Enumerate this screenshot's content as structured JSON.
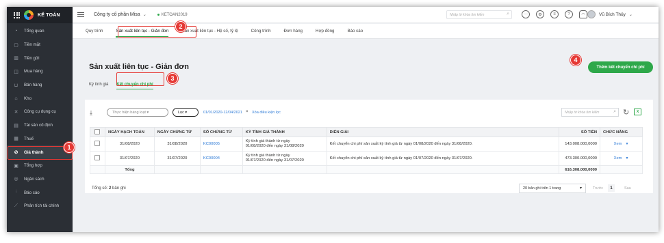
{
  "brand": {
    "name": "KẾ TOÁN"
  },
  "topbar": {
    "company": "Công ty cổ phần Misa",
    "year": "KETOAN2019",
    "search_placeholder": "Nhập từ khóa tìm kiếm",
    "user_name": "Vũ Bích Thủy"
  },
  "sidebar": {
    "items": [
      {
        "label": "Tổng quan",
        "icon": "dashboard-icon",
        "glyph": "◔"
      },
      {
        "label": "Tiền mặt",
        "icon": "cash-icon",
        "glyph": "▢"
      },
      {
        "label": "Tiền gửi",
        "icon": "bank-icon",
        "glyph": "▥"
      },
      {
        "label": "Mua hàng",
        "icon": "purchase-icon",
        "glyph": "◫"
      },
      {
        "label": "Bán hàng",
        "icon": "cart-icon",
        "glyph": "⊔"
      },
      {
        "label": "Kho",
        "icon": "warehouse-icon",
        "glyph": "⌂"
      },
      {
        "label": "Công cụ dụng cụ",
        "icon": "tools-icon",
        "glyph": "✕"
      },
      {
        "label": "Tài sản cố định",
        "icon": "asset-icon",
        "glyph": "▤"
      },
      {
        "label": "Thuế",
        "icon": "tax-icon",
        "glyph": "▦"
      },
      {
        "label": "Giá thành",
        "icon": "cost-icon",
        "glyph": "⊘"
      },
      {
        "label": "Tổng hợp",
        "icon": "summary-icon",
        "glyph": "▣"
      },
      {
        "label": "Ngân sách",
        "icon": "budget-icon",
        "glyph": "◎"
      },
      {
        "label": "Báo cáo",
        "icon": "report-icon",
        "glyph": "⫶"
      },
      {
        "label": "Phân tích tài chính",
        "icon": "analysis-icon",
        "glyph": "⟋"
      }
    ],
    "active_index": 9
  },
  "tabs": [
    "Quy trình",
    "Sản xuất liên tục - Giản đơn",
    "Sản xuất liên tục - Hệ số, tỷ lệ",
    "Công trình",
    "Đơn hàng",
    "Hợp đồng",
    "Báo cáo"
  ],
  "page": {
    "title": "Sản xuất liên tục - Giản đơn",
    "primary_button": "Thêm kết chuyển chi phí",
    "subtabs": [
      "Kỳ tính giá",
      "Kết chuyển chi phí"
    ]
  },
  "filters": {
    "status_placeholder": "Thực hiện hàng loạt",
    "filter_label": "Lọc",
    "date_range": "01/01/2020-12/04/2021",
    "clear_label": "Xóa điều kiện lọc",
    "search_placeholder": "Nhập từ khóa tìm kiếm"
  },
  "table": {
    "headers": [
      "NGÀY HẠCH TOÁN",
      "NGÀY CHỨNG TỪ",
      "SỐ CHỨNG TỪ",
      "KỲ TÍNH GIÁ THÀNH",
      "DIỄN GIẢI",
      "SỐ TIỀN",
      "CHỨC NĂNG"
    ],
    "rows": [
      {
        "ngay_hach_toan": "31/08/2020",
        "ngay_chung_tu": "31/08/2020",
        "so_chung_tu": "KC00005",
        "ky_line1": "Kỳ tính giá thành từ ngày",
        "ky_line2": "01/08/2020 đến ngày 31/08/2020",
        "dien_giai": "Kết chuyển chi phí sản xuất kỳ tính giá từ ngày 01/08/2020 đến ngày 31/08/2020.",
        "so_tien": "143.008.000,0000",
        "action": "Xem"
      },
      {
        "ngay_hach_toan": "31/07/2020",
        "ngay_chung_tu": "31/07/2020",
        "so_chung_tu": "KC00004",
        "ky_line1": "Kỳ tính giá thành từ ngày",
        "ky_line2": "01/07/2020 đến ngày 31/07/2020",
        "dien_giai": "Kết chuyển chi phí sản xuất kỳ tính giá từ ngày 01/07/2020 đến ngày 31/07/2020.",
        "so_tien": "473.300.000,0000",
        "action": "Xem"
      }
    ],
    "total_label": "Tổng",
    "total_value": "616.308.000,0000"
  },
  "footer": {
    "count_prefix": "Tổng số: ",
    "count_value": "2",
    "count_suffix": " bản ghi",
    "page_size": "20 bản ghi trên 1 trang",
    "prev": "Trước",
    "page": "1",
    "next": "Sau"
  },
  "annotations": [
    "1",
    "2",
    "3",
    "4"
  ],
  "colors": {
    "accent": "#2ea84a",
    "highlight": "#e53935",
    "link": "#2d7ad6",
    "sidebar": "#2b2f35"
  }
}
